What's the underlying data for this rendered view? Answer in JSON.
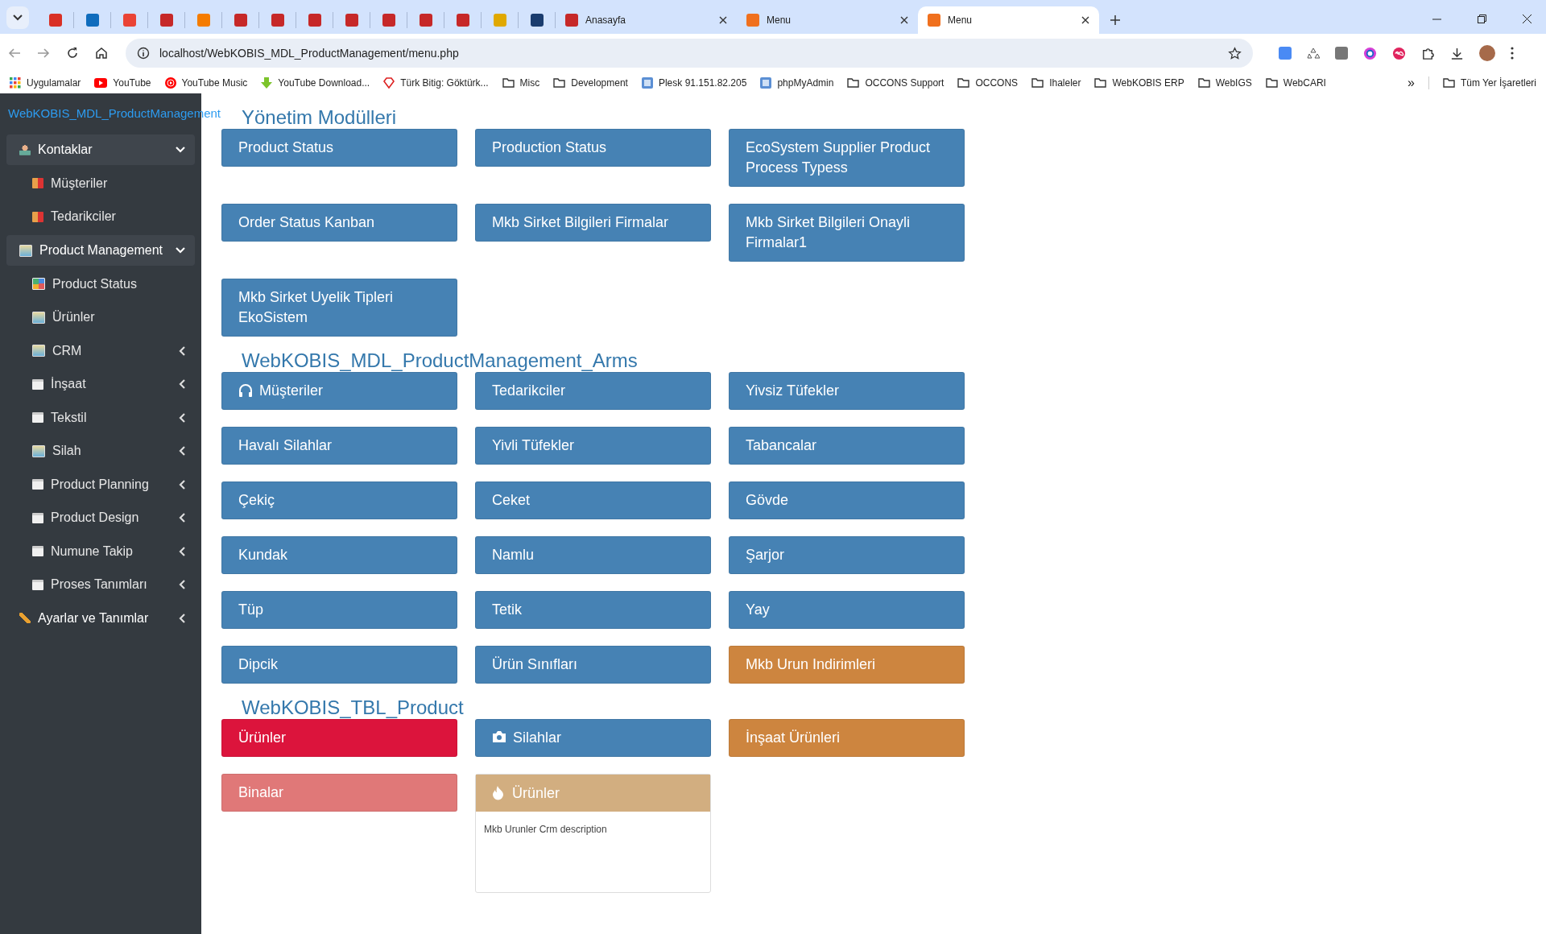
{
  "browser": {
    "tabs": [
      {
        "selected": false
      },
      {
        "selected": false
      },
      {
        "selected": false
      },
      {
        "selected": false
      },
      {
        "selected": false
      },
      {
        "selected": false
      },
      {
        "selected": false
      },
      {
        "selected": false
      },
      {
        "selected": false
      },
      {
        "selected": false
      },
      {
        "selected": false
      },
      {
        "selected": false
      },
      {
        "selected": false
      },
      {
        "selected": false
      },
      {
        "title": "Anasayfa",
        "selected": false
      },
      {
        "title": "Menu",
        "selected": false
      },
      {
        "title": "Menu",
        "selected": true
      }
    ],
    "url": "localhost/WebKOBIS_MDL_ProductManagement/menu.php",
    "bookmarks": [
      {
        "label": "Uygulamalar",
        "kind": "apps"
      },
      {
        "label": "YouTube",
        "kind": "youtube"
      },
      {
        "label": "YouTube Music",
        "kind": "music"
      },
      {
        "label": "YouTube Download...",
        "kind": "download"
      },
      {
        "label": "Türk Bitig: Göktürk...",
        "kind": "gem"
      },
      {
        "label": "Misc",
        "kind": "folder"
      },
      {
        "label": "Development",
        "kind": "folder"
      },
      {
        "label": "Plesk 91.151.82.205",
        "kind": "site"
      },
      {
        "label": "phpMyAdmin",
        "kind": "site"
      },
      {
        "label": "OCCONS Support",
        "kind": "folder"
      },
      {
        "label": "OCCONS",
        "kind": "folder"
      },
      {
        "label": "Ihaleler",
        "kind": "folder"
      },
      {
        "label": "WebKOBIS ERP",
        "kind": "folder"
      },
      {
        "label": "WebIGS",
        "kind": "folder"
      },
      {
        "label": "WebCARI",
        "kind": "folder"
      }
    ],
    "overflow": "»",
    "all_bookmarks": "Tüm Yer İşaretleri"
  },
  "sidebar": {
    "title": "WebKOBIS_MDL_ProductManagement",
    "items": [
      {
        "label": "Kontaklar",
        "expanded": true,
        "children": [
          {
            "label": "Müşteriler"
          },
          {
            "label": "Tedarikciler"
          }
        ]
      },
      {
        "label": "Product Management",
        "expanded": true,
        "children": [
          {
            "label": "Product Status"
          },
          {
            "label": "Ürünler"
          },
          {
            "label": "CRM",
            "expanded": false
          },
          {
            "label": "İnşaat",
            "expanded": false
          },
          {
            "label": "Tekstil",
            "expanded": false
          },
          {
            "label": "Silah",
            "expanded": false
          },
          {
            "label": "Product Planning",
            "expanded": false
          },
          {
            "label": "Product Design",
            "expanded": false
          },
          {
            "label": "Numune Takip",
            "expanded": false
          },
          {
            "label": "Proses Tanımları",
            "expanded": false
          }
        ]
      },
      {
        "label": "Ayarlar ve Tanımlar",
        "expanded": false
      }
    ]
  },
  "sections": [
    {
      "title": "Yönetim Modülleri",
      "items": [
        {
          "label": "Product Status",
          "kind": "button",
          "color": "#4682b4"
        },
        {
          "label": "Production Status",
          "kind": "button",
          "color": "#4682b4"
        },
        {
          "label": "EcoSystem Supplier Product Process Typess",
          "kind": "button",
          "color": "#4682b4"
        },
        {
          "label": "Order Status Kanban",
          "kind": "button",
          "color": "#4682b4"
        },
        {
          "label": "Mkb Sirket Bilgileri Firmalar",
          "kind": "button",
          "color": "#4682b4"
        },
        {
          "label": "Mkb Sirket Bilgileri Onayli Firmalar1",
          "kind": "button",
          "color": "#4682b4"
        },
        {
          "label": "Mkb Sirket Uyelik Tipleri EkoSistem",
          "kind": "button",
          "color": "#4682b4"
        }
      ]
    },
    {
      "title": "WebKOBIS_MDL_ProductManagement_Arms",
      "items": [
        {
          "label": "Müşteriler",
          "kind": "button",
          "color": "#4682b4"
        },
        {
          "label": "Tedarikciler",
          "kind": "button",
          "color": "#4682b4"
        },
        {
          "label": "Yivsiz Tüfekler",
          "kind": "button",
          "color": "#4682b4"
        },
        {
          "label": "Havalı Silahlar",
          "kind": "button",
          "color": "#4682b4"
        },
        {
          "label": "Yivli Tüfekler",
          "kind": "button",
          "color": "#4682b4"
        },
        {
          "label": "Tabancalar",
          "kind": "button",
          "color": "#4682b4"
        },
        {
          "label": "Çekiç",
          "kind": "button",
          "color": "#4682b4"
        },
        {
          "label": "Ceket",
          "kind": "button",
          "color": "#4682b4"
        },
        {
          "label": "Gövde",
          "kind": "button",
          "color": "#4682b4"
        },
        {
          "label": "Kundak",
          "kind": "button",
          "color": "#4682b4"
        },
        {
          "label": "Namlu",
          "kind": "button",
          "color": "#4682b4"
        },
        {
          "label": "Şarjor",
          "kind": "button",
          "color": "#4682b4"
        },
        {
          "label": "Tüp",
          "kind": "button",
          "color": "#4682b4"
        },
        {
          "label": "Tetik",
          "kind": "button",
          "color": "#4682b4"
        },
        {
          "label": "Yay",
          "kind": "button",
          "color": "#4682b4"
        },
        {
          "label": "Dipcik",
          "kind": "button",
          "color": "#4682b4"
        },
        {
          "label": "Ürün Sınıfları",
          "kind": "button",
          "color": "#4682b4"
        },
        {
          "label": "Mkb Urun Indirimleri",
          "kind": "button",
          "color": "#cd853f"
        }
      ]
    },
    {
      "title": "WebKOBIS_TBL_Product",
      "items": [
        {
          "label": "Ürünler",
          "kind": "button",
          "color": "#dc143c"
        },
        {
          "label": "Silahlar",
          "kind": "button",
          "color": "#4682b4"
        },
        {
          "label": "İnşaat Ürünleri",
          "kind": "button",
          "color": "#cd853f"
        },
        {
          "label": "Binalar",
          "kind": "button",
          "color": "#e07878"
        },
        {
          "label": "Ürünler",
          "kind": "card",
          "color": "#d2ae80",
          "description": "Mkb Urunler Crm description"
        }
      ]
    }
  ]
}
